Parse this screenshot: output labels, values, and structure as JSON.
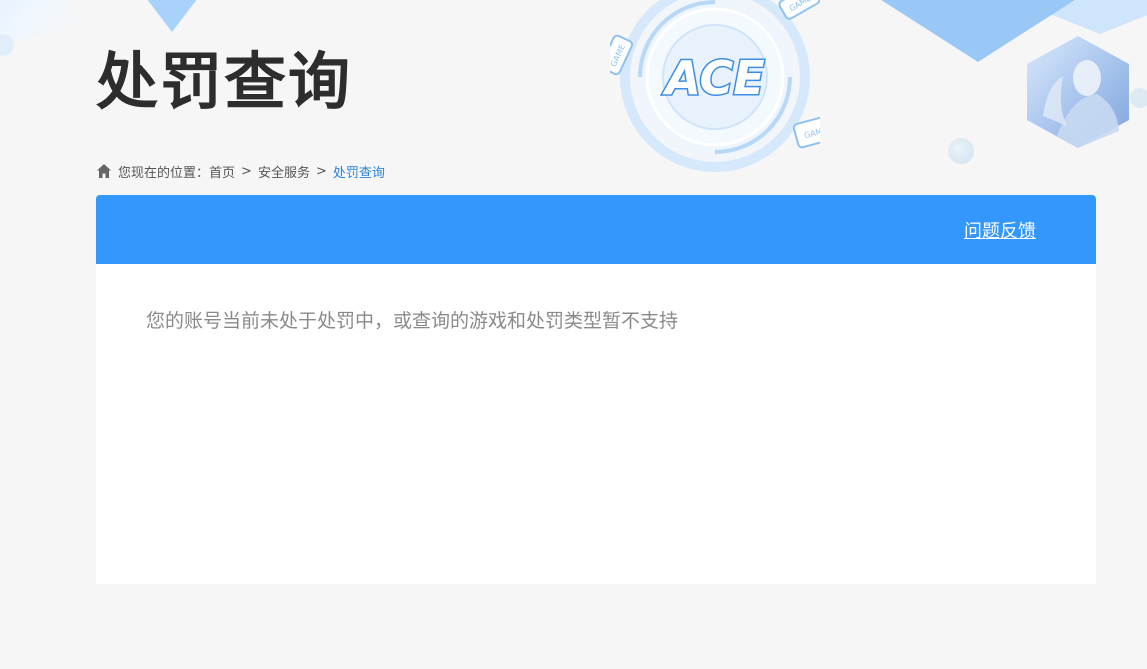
{
  "header": {
    "title": "处罚查询",
    "emblem_text": "ACE",
    "game_tag": "GAME"
  },
  "breadcrumb": {
    "prefix": "您现在的位置：",
    "items": [
      {
        "label": "首页"
      },
      {
        "label": "安全服务"
      },
      {
        "label": "处罚查询"
      }
    ],
    "separator": ">"
  },
  "card": {
    "feedback_label": "问题反馈",
    "message": "您的账号当前未处于处罚中，或查询的游戏和处罚类型暂不支持"
  },
  "colors": {
    "accent": "#3397fd",
    "breadcrumb_current": "#2a83d8",
    "title": "#2d2d2d",
    "message": "#8a8a8a"
  },
  "icons": {
    "breadcrumb_home": "home-icon"
  }
}
